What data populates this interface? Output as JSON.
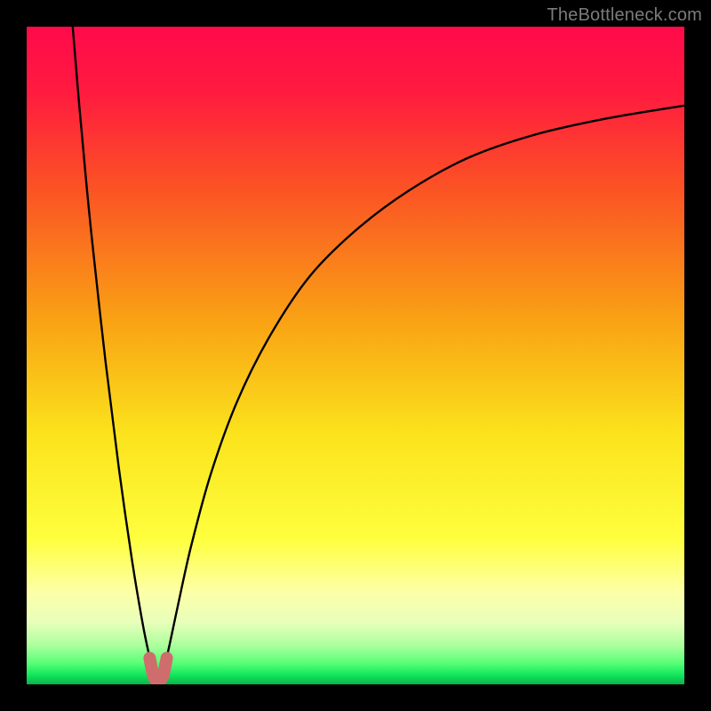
{
  "attribution": "TheBottleneck.com",
  "chart_data": {
    "type": "line",
    "title": "",
    "xlabel": "",
    "ylabel": "",
    "xlim": [
      0,
      100
    ],
    "ylim": [
      0,
      100
    ],
    "background_gradient": {
      "stops": [
        {
          "offset": 0.0,
          "color": "#ff0a4a"
        },
        {
          "offset": 0.1,
          "color": "#ff1b3f"
        },
        {
          "offset": 0.25,
          "color": "#fb5424"
        },
        {
          "offset": 0.45,
          "color": "#f9a314"
        },
        {
          "offset": 0.62,
          "color": "#fbe31c"
        },
        {
          "offset": 0.78,
          "color": "#feff3e"
        },
        {
          "offset": 0.86,
          "color": "#fdffa8"
        },
        {
          "offset": 0.905,
          "color": "#e8ffba"
        },
        {
          "offset": 0.94,
          "color": "#aeff9f"
        },
        {
          "offset": 0.968,
          "color": "#57ff77"
        },
        {
          "offset": 0.985,
          "color": "#14e85d"
        },
        {
          "offset": 1.0,
          "color": "#05b64a"
        }
      ]
    },
    "series": [
      {
        "name": "bottleneck-curve",
        "x": [
          7,
          8,
          9,
          10,
          12,
          14,
          16,
          17.5,
          18.5,
          19.3,
          20,
          20.7,
          21.5,
          23,
          25,
          28,
          32,
          37,
          43,
          50,
          58,
          67,
          77,
          88,
          100
        ],
        "y": [
          100,
          88,
          77,
          67,
          49,
          33,
          19,
          10,
          5,
          2,
          1,
          2,
          5,
          12,
          21,
          32,
          43,
          53,
          62,
          69,
          75,
          80,
          83.5,
          86,
          88
        ]
      }
    ],
    "marker": {
      "name": "optimal-region-marker",
      "color": "#cf6d6d",
      "x": [
        18.7,
        19.3,
        20,
        20.7,
        21.3
      ],
      "y": [
        4.0,
        1.2,
        0.6,
        1.2,
        4.0
      ]
    }
  }
}
